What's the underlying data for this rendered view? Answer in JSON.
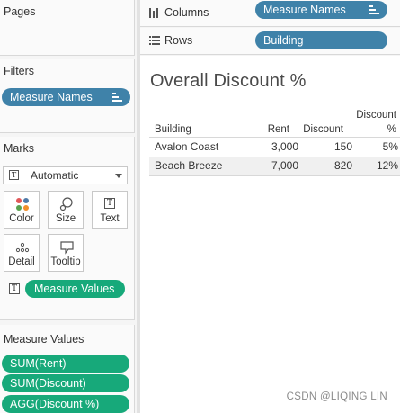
{
  "pages": {
    "title": "Pages"
  },
  "columns_shelf": {
    "label": "Columns",
    "pill": "Measure Names"
  },
  "rows_shelf": {
    "label": "Rows",
    "pill": "Building"
  },
  "filters": {
    "title": "Filters",
    "pill": "Measure Names"
  },
  "marks": {
    "title": "Marks",
    "mark_type": "Automatic",
    "buttons": {
      "color": "Color",
      "size": "Size",
      "text": "Text",
      "detail": "Detail",
      "tooltip": "Tooltip"
    },
    "field_pill": "Measure Values"
  },
  "measure_values": {
    "title": "Measure Values",
    "items": [
      "SUM(Rent)",
      "SUM(Discount)",
      "AGG(Discount %)"
    ]
  },
  "view": {
    "title": "Overall Discount %",
    "headers": {
      "building": "Building",
      "rent": "Rent",
      "discount": "Discount",
      "discount_pct_line1": "Discount",
      "discount_pct_line2": "%"
    },
    "rows": [
      {
        "building": "Avalon Coast",
        "rent": "3,000",
        "discount": "150",
        "discount_pct": "5%"
      },
      {
        "building": "Beach Breeze",
        "rent": "7,000",
        "discount": "820",
        "discount_pct": "12%"
      }
    ]
  },
  "watermark": "CSDN @LIQING LIN",
  "colors": {
    "dimension_pill": "#3f82a9",
    "measure_pill": "#17a97a",
    "accent_row": "#f0f0f0"
  }
}
